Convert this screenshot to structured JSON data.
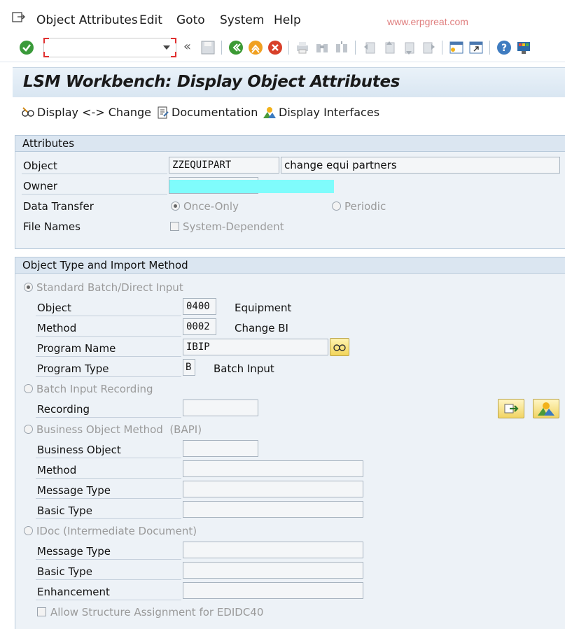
{
  "menubar": {
    "items": [
      "Object Attributes",
      "Edit",
      "Goto",
      "System",
      "Help"
    ],
    "watermark": "www.erpgreat.com"
  },
  "toolbar": {
    "command_value": "",
    "icons": [
      "enter-icon",
      "save-icon",
      "back-icon",
      "exit-icon",
      "cancel-icon",
      "print-icon",
      "find-icon",
      "find-next-icon",
      "first-page-icon",
      "previous-page-icon",
      "next-page-icon",
      "last-page-icon",
      "create-session-icon",
      "shortcut-icon",
      "help-icon",
      "customize-layout-icon"
    ]
  },
  "title": "LSM Workbench: Display Object Attributes",
  "app_toolbar": {
    "display_change": "Display <-> Change",
    "documentation": "Documentation",
    "display_interfaces": "Display Interfaces"
  },
  "attributes": {
    "header": "Attributes",
    "object_label": "Object",
    "object_value": "ZZEQUIPART",
    "object_desc": "change equi partners",
    "owner_label": "Owner",
    "owner_value": "",
    "data_transfer_label": "Data Transfer",
    "once_only": "Once-Only",
    "periodic": "Periodic",
    "file_names_label": "File Names",
    "system_dependent": "System-Dependent"
  },
  "import": {
    "header": "Object Type and Import Method",
    "standard_batch": "Standard Batch/Direct Input",
    "object_label": "Object",
    "object_value": "0400",
    "object_desc": "Equipment",
    "method_label": "Method",
    "method_value": "0002",
    "method_desc": "Change BI",
    "program_name_label": "Program Name",
    "program_name_value": "IBIP",
    "program_type_label": "Program Type",
    "program_type_value": "B",
    "program_type_desc": "Batch Input",
    "batch_recording": "Batch Input Recording",
    "recording_label": "Recording",
    "bapi": "Business Object Method  (BAPI)",
    "business_object_label": "Business Object",
    "bapi_method_label": "Method",
    "bapi_message_type_label": "Message Type",
    "bapi_basic_type_label": "Basic Type",
    "idoc": "IDoc (Intermediate Document)",
    "idoc_message_type_label": "Message Type",
    "idoc_basic_type_label": "Basic Type",
    "enhancement_label": "Enhancement",
    "allow_structure": "Allow Structure Assignment for EDIDC40"
  },
  "colors": {
    "owner_highlight": "#7ffcfc",
    "frame_bg": "#edf2f7",
    "frame_head": "#dbe6f1"
  }
}
